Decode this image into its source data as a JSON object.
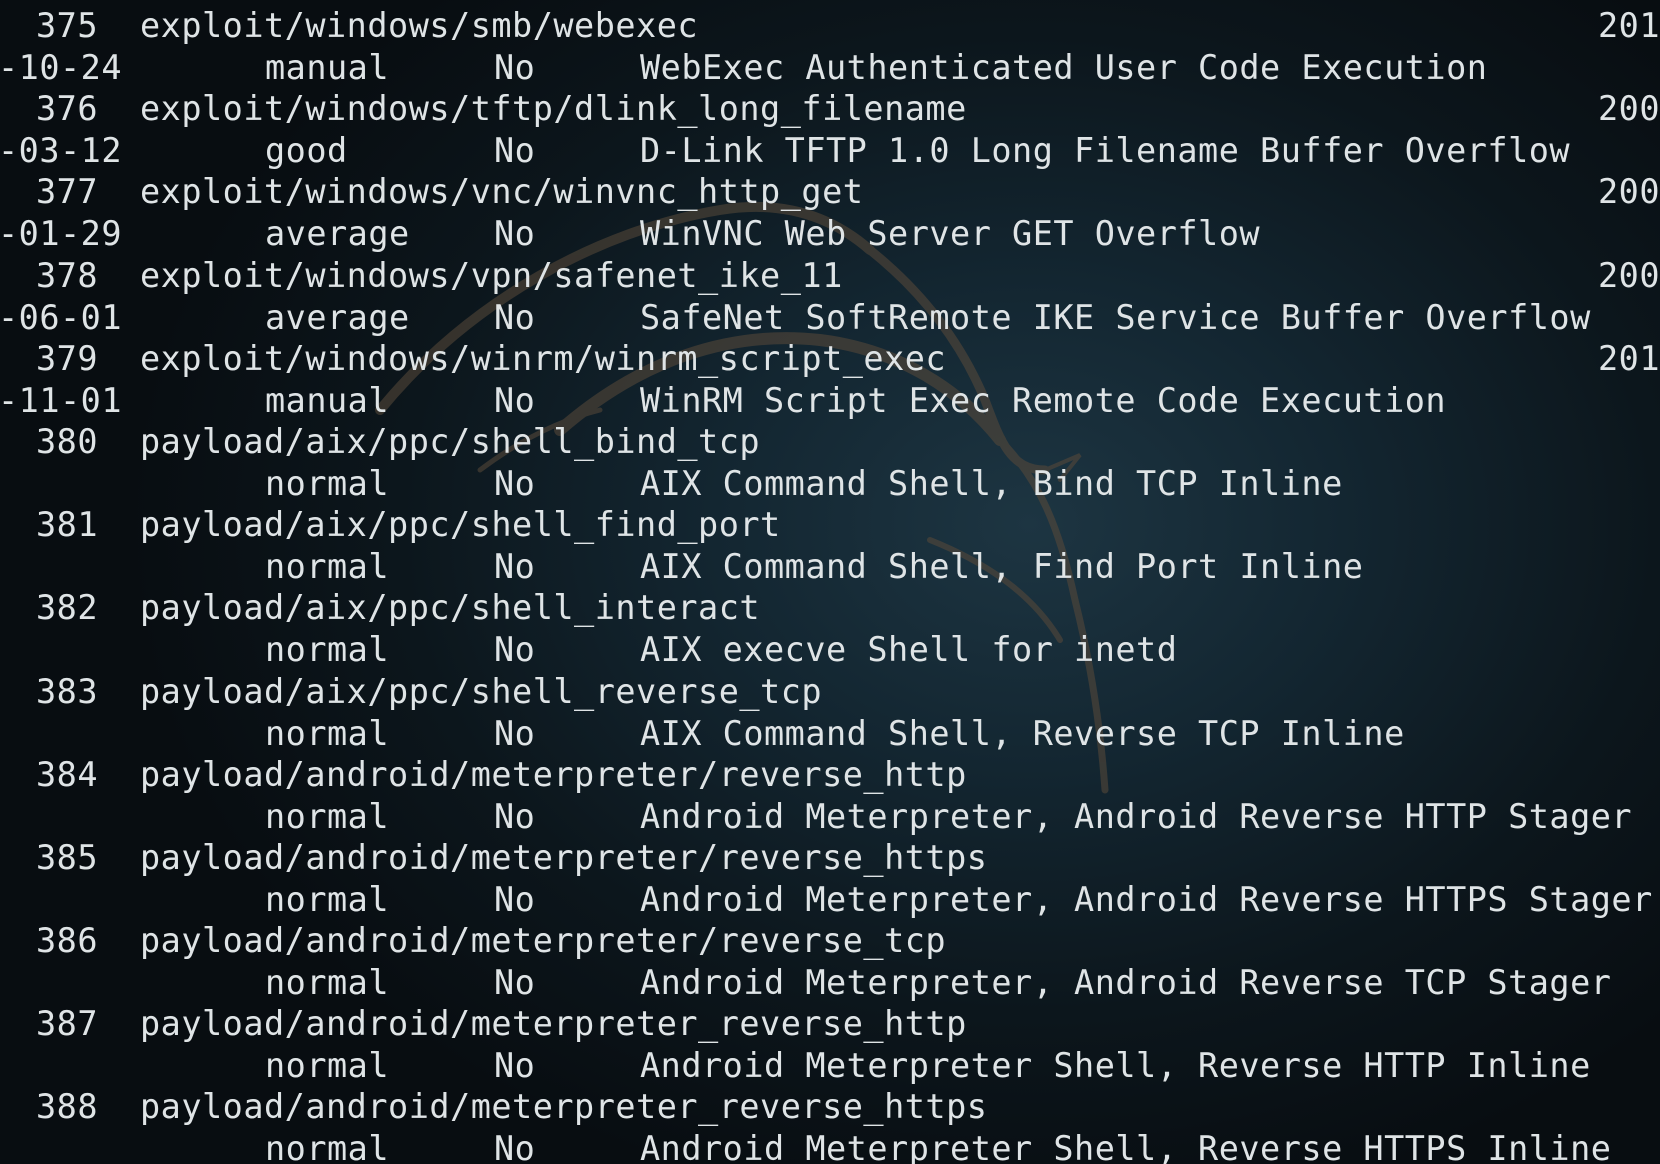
{
  "terminal": {
    "accent_text_color": "#dfe4e6",
    "background_color": "#0c161c",
    "watermark_icon": "kali-dragon-icon",
    "rows": [
      {
        "num": "375",
        "name": "exploit/windows/smb/webexec",
        "date_head": "201",
        "date_tail": "-10-24",
        "rank": "manual",
        "check": "No",
        "desc": "WebExec Authenticated User Code Execution"
      },
      {
        "num": "376",
        "name": "exploit/windows/tftp/dlink_long_filename",
        "date_head": "200",
        "date_tail": "-03-12",
        "rank": "good",
        "check": "No",
        "desc": "D-Link TFTP 1.0 Long Filename Buffer Overflow"
      },
      {
        "num": "377",
        "name": "exploit/windows/vnc/winvnc_http_get",
        "date_head": "200",
        "date_tail": "-01-29",
        "rank": "average",
        "check": "No",
        "desc": "WinVNC Web Server GET Overflow"
      },
      {
        "num": "378",
        "name": "exploit/windows/vpn/safenet_ike_11",
        "date_head": "200",
        "date_tail": "-06-01",
        "rank": "average",
        "check": "No",
        "desc": "SafeNet SoftRemote IKE Service Buffer Overflow"
      },
      {
        "num": "379",
        "name": "exploit/windows/winrm/winrm_script_exec",
        "date_head": "201",
        "date_tail": "-11-01",
        "rank": "manual",
        "check": "No",
        "desc": "WinRM Script Exec Remote Code Execution"
      },
      {
        "num": "380",
        "name": "payload/aix/ppc/shell_bind_tcp",
        "date_head": "",
        "date_tail": "",
        "rank": "normal",
        "check": "No",
        "desc": "AIX Command Shell, Bind TCP Inline"
      },
      {
        "num": "381",
        "name": "payload/aix/ppc/shell_find_port",
        "date_head": "",
        "date_tail": "",
        "rank": "normal",
        "check": "No",
        "desc": "AIX Command Shell, Find Port Inline"
      },
      {
        "num": "382",
        "name": "payload/aix/ppc/shell_interact",
        "date_head": "",
        "date_tail": "",
        "rank": "normal",
        "check": "No",
        "desc": "AIX execve Shell for inetd"
      },
      {
        "num": "383",
        "name": "payload/aix/ppc/shell_reverse_tcp",
        "date_head": "",
        "date_tail": "",
        "rank": "normal",
        "check": "No",
        "desc": "AIX Command Shell, Reverse TCP Inline"
      },
      {
        "num": "384",
        "name": "payload/android/meterpreter/reverse_http",
        "date_head": "",
        "date_tail": "",
        "rank": "normal",
        "check": "No",
        "desc": "Android Meterpreter, Android Reverse HTTP Stager"
      },
      {
        "num": "385",
        "name": "payload/android/meterpreter/reverse_https",
        "date_head": "",
        "date_tail": "",
        "rank": "normal",
        "check": "No",
        "desc": "Android Meterpreter, Android Reverse HTTPS Stager"
      },
      {
        "num": "386",
        "name": "payload/android/meterpreter/reverse_tcp",
        "date_head": "",
        "date_tail": "",
        "rank": "normal",
        "check": "No",
        "desc": "Android Meterpreter, Android Reverse TCP Stager"
      },
      {
        "num": "387",
        "name": "payload/android/meterpreter_reverse_http",
        "date_head": "",
        "date_tail": "",
        "rank": "normal",
        "check": "No",
        "desc": "Android Meterpreter Shell, Reverse HTTP Inline"
      },
      {
        "num": "388",
        "name": "payload/android/meterpreter_reverse_https",
        "date_head": "",
        "date_tail": "",
        "rank": "normal",
        "check": "No",
        "desc": "Android Meterpreter Shell, Reverse HTTPS Inline"
      }
    ]
  }
}
